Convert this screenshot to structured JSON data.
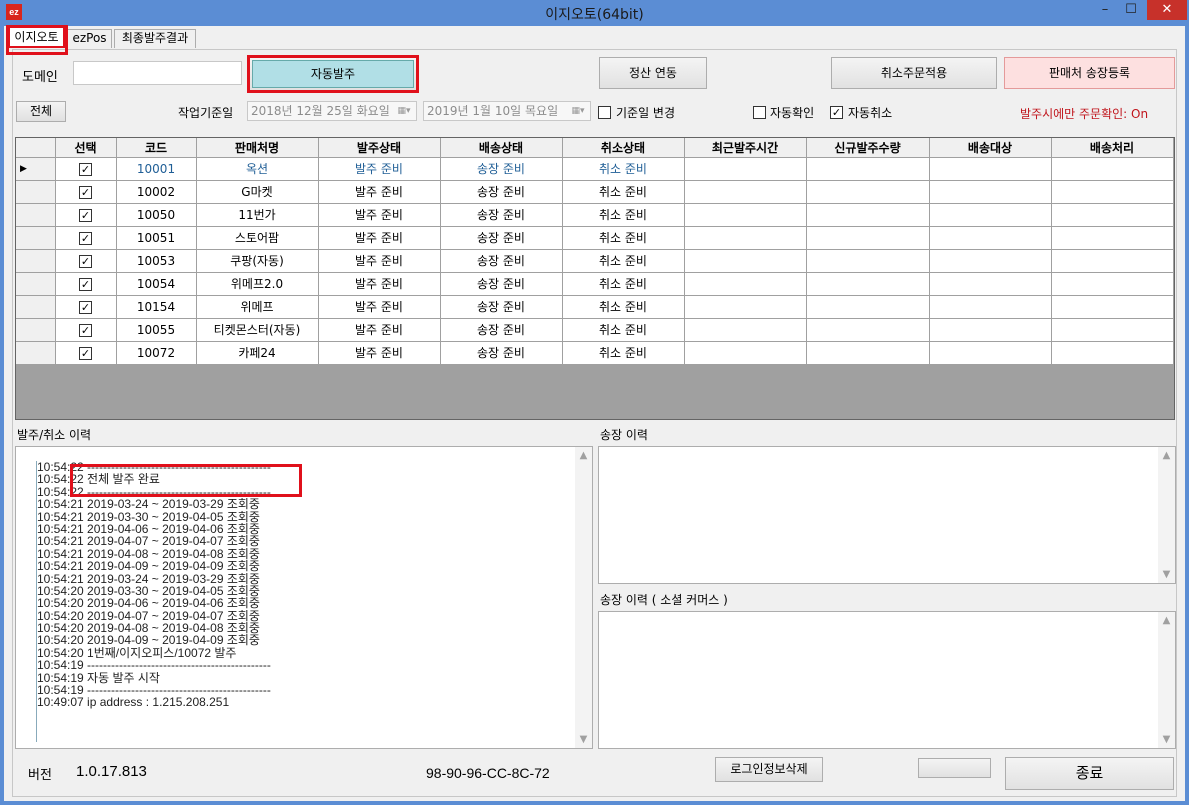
{
  "window": {
    "title": "이지오토(64bit)",
    "logo": "ez",
    "minimize": "–",
    "maximize": "☐",
    "close": "✕"
  },
  "tabs": [
    "이지오토",
    "ezPos",
    "최종발주결과"
  ],
  "top": {
    "domain_label": "도메인",
    "domain_value": "",
    "auto_order_button": "자동발주",
    "settle_button": "정산 연동",
    "cancel_apply_button": "취소주문적용",
    "seller_invoice_button": "판매처 송장등록"
  },
  "filter": {
    "all_button": "전체",
    "work_date_label": "작업기준일",
    "date_from": "2018년 12월 25일 화요일",
    "date_to": "2019년   1월 10일 목요일",
    "change_base_date": {
      "label": "기준일 변경",
      "checked": false
    },
    "auto_confirm": {
      "label": "자동확인",
      "checked": false
    },
    "auto_cancel": {
      "label": "자동취소",
      "checked": true
    },
    "notice": "발주시에만 주문확인: On",
    "notice_color": "#c0141b"
  },
  "grid": {
    "columns": [
      "선택",
      "코드",
      "판매처명",
      "발주상태",
      "배송상태",
      "취소상태",
      "최근발주시간",
      "신규발주수량",
      "배송대상",
      "배송처리"
    ],
    "rows": [
      {
        "code": "10001",
        "name": "옥션",
        "order": "발주 준비",
        "ship": "송장 준비",
        "cancel": "취소 준비"
      },
      {
        "code": "10002",
        "name": "G마켓",
        "order": "발주 준비",
        "ship": "송장 준비",
        "cancel": "취소 준비"
      },
      {
        "code": "10050",
        "name": "11번가",
        "order": "발주 준비",
        "ship": "송장 준비",
        "cancel": "취소 준비"
      },
      {
        "code": "10051",
        "name": "스토어팜",
        "order": "발주 준비",
        "ship": "송장 준비",
        "cancel": "취소 준비"
      },
      {
        "code": "10053",
        "name": "쿠팡(자동)",
        "order": "발주 준비",
        "ship": "송장 준비",
        "cancel": "취소 준비"
      },
      {
        "code": "10054",
        "name": "위메프2.0",
        "order": "발주 준비",
        "ship": "송장 준비",
        "cancel": "취소 준비"
      },
      {
        "code": "10154",
        "name": "위메프",
        "order": "발주 준비",
        "ship": "송장 준비",
        "cancel": "취소 준비"
      },
      {
        "code": "10055",
        "name": "티켓몬스터(자동)",
        "order": "발주 준비",
        "ship": "송장 준비",
        "cancel": "취소 준비"
      },
      {
        "code": "10072",
        "name": "카페24",
        "order": "발주 준비",
        "ship": "송장 준비",
        "cancel": "취소 준비"
      }
    ]
  },
  "logs": {
    "order_cancel_label": "발주/취소 이력",
    "invoice_label": "송장 이력",
    "social_invoice_label": "송장 이력 ( 소셜 커머스 )",
    "lines": [
      "10:54:22 ----------------------------------------------",
      "10:54:22          전체 발주 완료",
      "10:54:22 ----------------------------------------------",
      "10:54:21 2019-03-24 ~ 2019-03-29 조회중",
      "10:54:21 2019-03-30 ~ 2019-04-05 조회중",
      "10:54:21 2019-04-06 ~ 2019-04-06 조회중",
      "10:54:21 2019-04-07 ~ 2019-04-07 조회중",
      "10:54:21 2019-04-08 ~ 2019-04-08 조회중",
      "10:54:21 2019-04-09 ~ 2019-04-09 조회중",
      "10:54:21 2019-03-24 ~ 2019-03-29 조회중",
      "10:54:20 2019-03-30 ~ 2019-04-05 조회중",
      "10:54:20 2019-04-06 ~ 2019-04-06 조회중",
      "10:54:20 2019-04-07 ~ 2019-04-07 조회중",
      "10:54:20 2019-04-08 ~ 2019-04-08 조회중",
      "10:54:20 2019-04-09 ~ 2019-04-09 조회중",
      "10:54:20 1번째/이지오피스/10072  발주",
      "10:54:19 ----------------------------------------------",
      "10:54:19          자동 발주 시작",
      "10:54:19 ----------------------------------------------",
      "10:49:07 ip address : 1.215.208.251"
    ]
  },
  "footer": {
    "version_label": "버전",
    "version": "1.0.17.813",
    "mac": "98-90-96-CC-8C-72",
    "clear_login_button": "로그인정보삭제",
    "blank_button": "",
    "exit_button": "종료"
  },
  "colors": {
    "highlight_red": "#e0101b",
    "auto_order_bg": "#b1dfe6",
    "invoice_register_bg": "#fde0e0",
    "title_bar": "#5b8dd4"
  }
}
